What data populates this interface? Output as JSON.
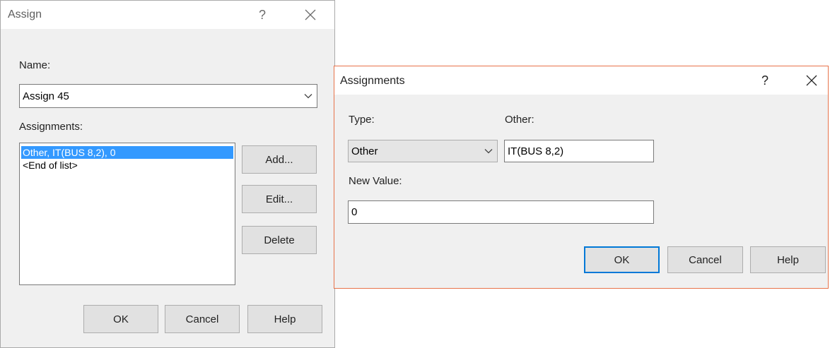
{
  "assign_dialog": {
    "title": "Assign",
    "help_glyph": "?",
    "name_label": "Name:",
    "name_value": "Assign 45",
    "assignments_label": "Assignments:",
    "list_items": [
      {
        "text": "Other, IT(BUS 8,2), 0",
        "selected": true
      },
      {
        "text": "<End of list>",
        "selected": false
      }
    ],
    "add_label": "Add...",
    "edit_label": "Edit...",
    "delete_label": "Delete",
    "ok_label": "OK",
    "cancel_label": "Cancel",
    "help_label": "Help"
  },
  "assignments_dialog": {
    "title": "Assignments",
    "help_glyph": "?",
    "type_label": "Type:",
    "type_value": "Other",
    "other_label": "Other:",
    "other_value": "IT(BUS 8,2)",
    "new_value_label": "New Value:",
    "new_value": "0",
    "ok_label": "OK",
    "cancel_label": "Cancel",
    "help_label": "Help",
    "border_color": "#e8734a"
  },
  "colors": {
    "dialog_bg": "#f0f0f0",
    "selection": "#3399ff",
    "default_button_border": "#0078d7"
  }
}
